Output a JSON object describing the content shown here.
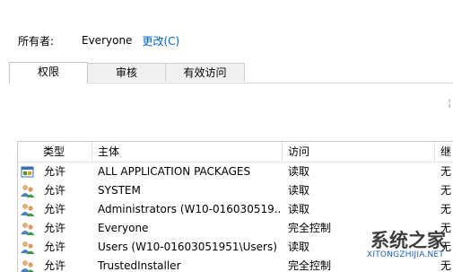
{
  "owner": {
    "label": "所有者:",
    "value": "Everyone",
    "change_link": "更改(C)"
  },
  "tabs": [
    {
      "label": "权限",
      "active": true
    },
    {
      "label": "审核",
      "active": false
    },
    {
      "label": "有效访问",
      "active": false
    }
  ],
  "side_mark": "¦",
  "table": {
    "headers": [
      "类型",
      "主体",
      "访问",
      "继"
    ],
    "rows": [
      {
        "icon": "app-package-icon",
        "type": "允许",
        "principal": "ALL APPLICATION PACKAGES",
        "access": "读取",
        "inherit": "无"
      },
      {
        "icon": "user-group-icon",
        "type": "允许",
        "principal": "SYSTEM",
        "access": "读取",
        "inherit": "无"
      },
      {
        "icon": "user-group-icon",
        "type": "允许",
        "principal": "Administrators (W10-016030519...",
        "access": "读取",
        "inherit": "无"
      },
      {
        "icon": "user-group-icon",
        "type": "允许",
        "principal": "Everyone",
        "access": "完全控制",
        "inherit": "无"
      },
      {
        "icon": "user-group-icon",
        "type": "允许",
        "principal": "Users (W10-01603051951\\Users)",
        "access": "读取",
        "inherit": "无"
      },
      {
        "icon": "user-group-icon",
        "type": "允许",
        "principal": "TrustedInstaller",
        "access": "完全控制",
        "inherit": "无"
      }
    ]
  },
  "watermark": {
    "main": "系统之家",
    "sub": "XITONGZHIJIA.NET"
  },
  "colors": {
    "link": "#0066cc",
    "tab_bg": "#f0f0f0",
    "border": "#c8c8c8"
  }
}
